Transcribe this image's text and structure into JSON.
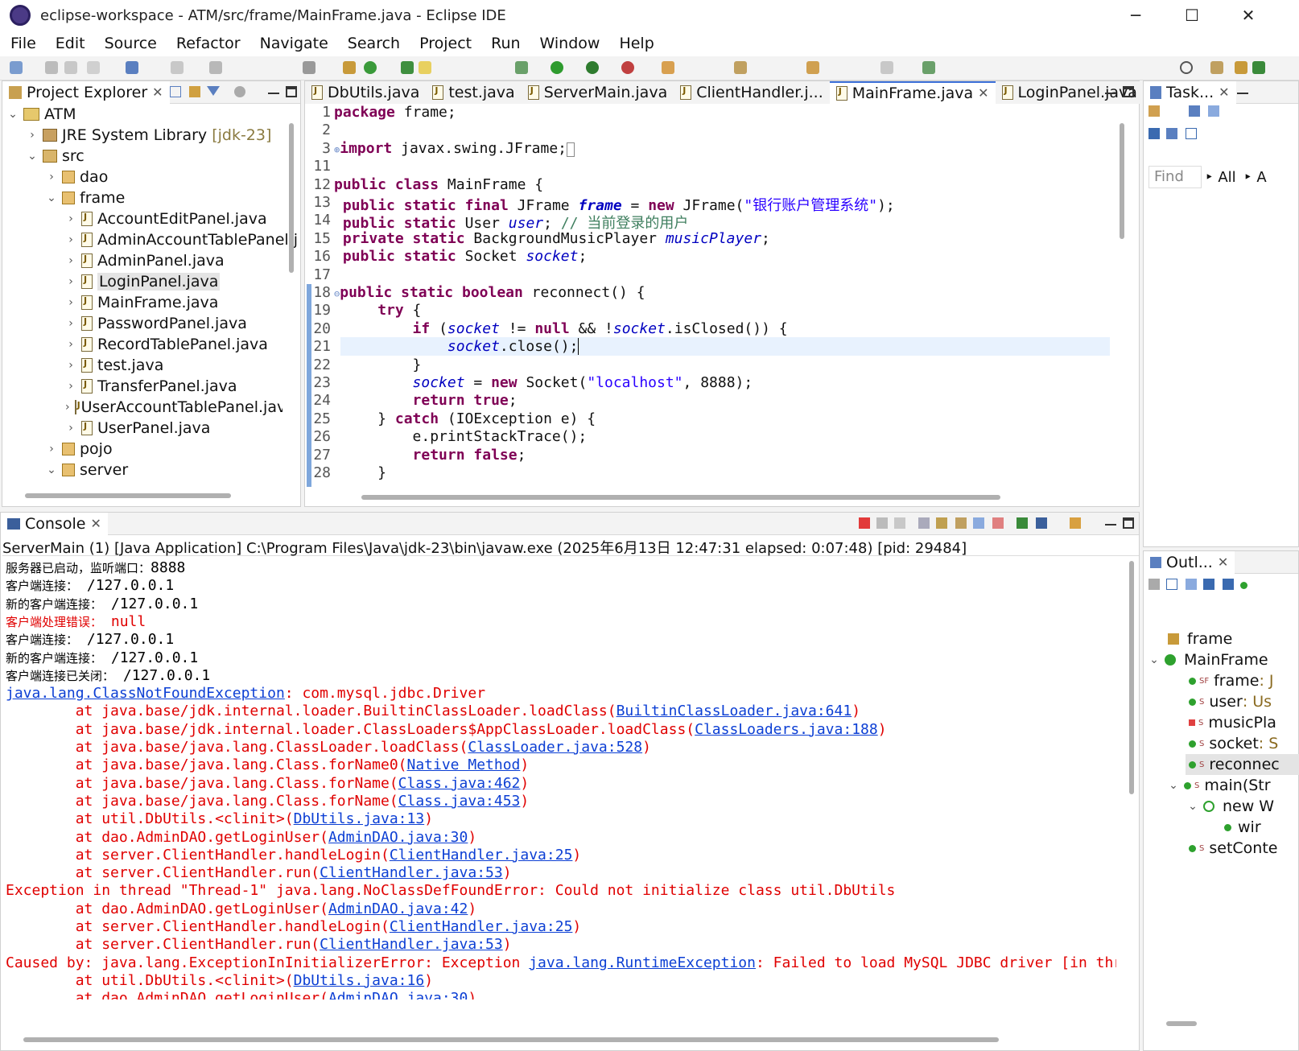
{
  "window": {
    "title": "eclipse-workspace - ATM/src/frame/MainFrame.java - Eclipse IDE",
    "minimize": "─",
    "maximize": "☐",
    "close": "✕"
  },
  "menu": [
    "File",
    "Edit",
    "Source",
    "Refactor",
    "Navigate",
    "Search",
    "Project",
    "Run",
    "Window",
    "Help"
  ],
  "project_explorer": {
    "tab_label": "Project Explorer",
    "tree": [
      {
        "label": "ATM",
        "twisty": "⌄",
        "icon": "project-icon"
      },
      {
        "label": "JRE System Library",
        "extra": "[jdk-23]",
        "twisty": "›",
        "icon": "library-icon"
      },
      {
        "label": "src",
        "twisty": "⌄",
        "icon": "source-folder-icon"
      },
      {
        "label": "dao",
        "twisty": "›",
        "icon": "package-icon"
      },
      {
        "label": "frame",
        "twisty": "⌄",
        "icon": "package-icon"
      },
      {
        "label": "AccountEditPanel.java",
        "twisty": "›",
        "icon": "java-file-icon"
      },
      {
        "label": "AdminAccountTablePanel.j",
        "twisty": "›",
        "icon": "java-file-icon"
      },
      {
        "label": "AdminPanel.java",
        "twisty": "›",
        "icon": "java-file-icon"
      },
      {
        "label": "LoginPanel.java",
        "twisty": "›",
        "icon": "java-file-icon"
      },
      {
        "label": "MainFrame.java",
        "twisty": "›",
        "icon": "java-file-icon"
      },
      {
        "label": "PasswordPanel.java",
        "twisty": "›",
        "icon": "java-file-icon"
      },
      {
        "label": "RecordTablePanel.java",
        "twisty": "›",
        "icon": "java-file-icon"
      },
      {
        "label": "test.java",
        "twisty": "›",
        "icon": "java-file-icon"
      },
      {
        "label": "TransferPanel.java",
        "twisty": "›",
        "icon": "java-file-icon"
      },
      {
        "label": "UserAccountTablePanel.java",
        "twisty": "›",
        "icon": "java-file-icon"
      },
      {
        "label": "UserPanel.java",
        "twisty": "›",
        "icon": "java-file-icon"
      },
      {
        "label": "pojo",
        "twisty": "›",
        "icon": "package-icon"
      },
      {
        "label": "server",
        "twisty": "⌄",
        "icon": "package-icon"
      }
    ]
  },
  "editor": {
    "tabs": [
      "DbUtils.java",
      "test.java",
      "ServerMain.java",
      "ClientHandler.j...",
      "MainFrame.java",
      "LoginPanel.java"
    ],
    "active_tab": "MainFrame.java",
    "line_numbers": [
      "1",
      "2",
      "3",
      "11",
      "12",
      "13",
      "14",
      "15",
      "16",
      "17",
      "18",
      "19",
      "20",
      "21",
      "22",
      "23",
      "24",
      "25",
      "26",
      "27",
      "28"
    ]
  },
  "task_view": {
    "tab_label": "Task...",
    "find_placeholder": "Find",
    "all_label": "All",
    "a_label": "A"
  },
  "console": {
    "tab_label": "Console",
    "launch_info": "ServerMain (1) [Java Application] C:\\Program Files\\Java\\jdk-23\\bin\\javaw.exe  (2025年6月13日 12:47:31 elapsed: 0:07:48) [pid: 29484]"
  },
  "outline": {
    "tab_label": "Outl...",
    "items": [
      {
        "label": "frame",
        "extra": ""
      },
      {
        "label": "MainFrame",
        "extra": ""
      },
      {
        "label": "frame",
        "extra": " : J"
      },
      {
        "label": "user",
        "extra": " : Us"
      },
      {
        "label": "musicPla",
        "extra": ""
      },
      {
        "label": "socket",
        "extra": " : S"
      },
      {
        "label": "reconnec",
        "extra": ""
      },
      {
        "label": "main(Str",
        "extra": ""
      },
      {
        "label": "new W",
        "extra": ""
      },
      {
        "label": "wir",
        "extra": ""
      },
      {
        "label": "setConte",
        "extra": ""
      }
    ]
  },
  "colors": {
    "error": "#e00000",
    "link": "#0c3fd4",
    "keyword": "#7f0055",
    "field": "#0000c0",
    "string": "#2a00ff",
    "comment": "#3f7f5f"
  }
}
